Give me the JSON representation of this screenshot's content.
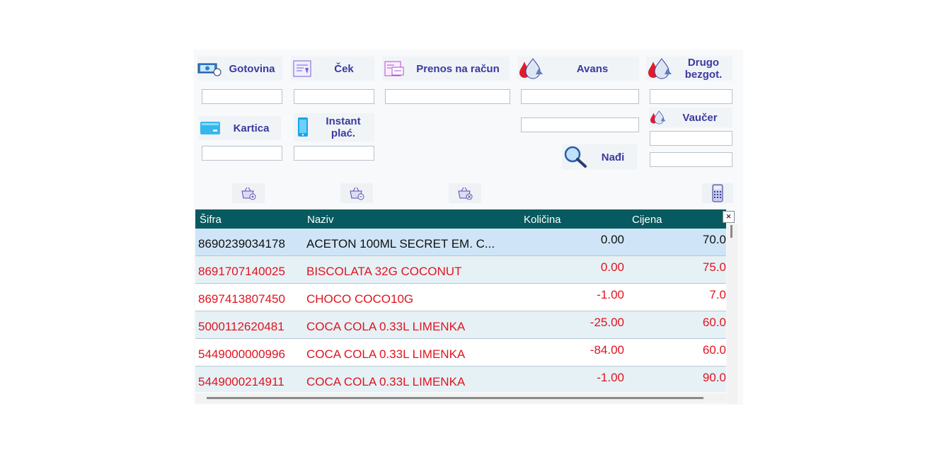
{
  "payments": {
    "cash": {
      "label": "Gotovina",
      "value": ""
    },
    "check": {
      "label": "Ček",
      "value": ""
    },
    "transfer": {
      "label": "Prenos na račun",
      "value": ""
    },
    "advance": {
      "label": "Avans",
      "value": ""
    },
    "other_noncash_line1": "Drugo",
    "other_noncash_line2": "bezgot.",
    "other_noncash_value": "",
    "card": {
      "label": "Kartica",
      "value": ""
    },
    "instant_line1": "Instant",
    "instant_line2": "plać.",
    "instant_value": "",
    "advance_extra_value": "",
    "voucher": {
      "label": "Vaučer",
      "value": ""
    },
    "voucher_extra_value": "",
    "find": {
      "label": "Nađi"
    }
  },
  "grid": {
    "columns": {
      "code": "Šifra",
      "name": "Naziv",
      "qty": "Količina",
      "price": "Cijena"
    },
    "close_label": "×",
    "rows": [
      {
        "code": "8690239034178",
        "name": "ACETON 100ML SECRET EM. C...",
        "qty": "0.00",
        "price": "70.0",
        "color": "#111111"
      },
      {
        "code": "8691707140025",
        "name": "BISCOLATA 32G COCONUT",
        "qty": "0.00",
        "price": "75.0",
        "color": "#e0141e"
      },
      {
        "code": "8697413807450",
        "name": "CHOCO COCO10G",
        "qty": "-1.00",
        "price": "7.0",
        "color": "#e0141e"
      },
      {
        "code": "5000112620481",
        "name": "COCA COLA 0.33L LIMENKA",
        "qty": "-25.00",
        "price": "60.0",
        "color": "#e0141e"
      },
      {
        "code": "5449000000996",
        "name": "COCA COLA 0.33L LIMENKA",
        "qty": "-84.00",
        "price": "60.0",
        "color": "#e0141e"
      },
      {
        "code": "5449000214911",
        "name": "COCA COLA 0.33L LIMENKA",
        "qty": "-1.00",
        "price": "90.0",
        "color": "#e0141e"
      }
    ]
  },
  "colors": {
    "accent": "#3a3aa0",
    "header": "#075a5f",
    "selected_row": "#cfe5f7",
    "alt_row": "#e6f1f6",
    "negative": "#e0141e"
  }
}
